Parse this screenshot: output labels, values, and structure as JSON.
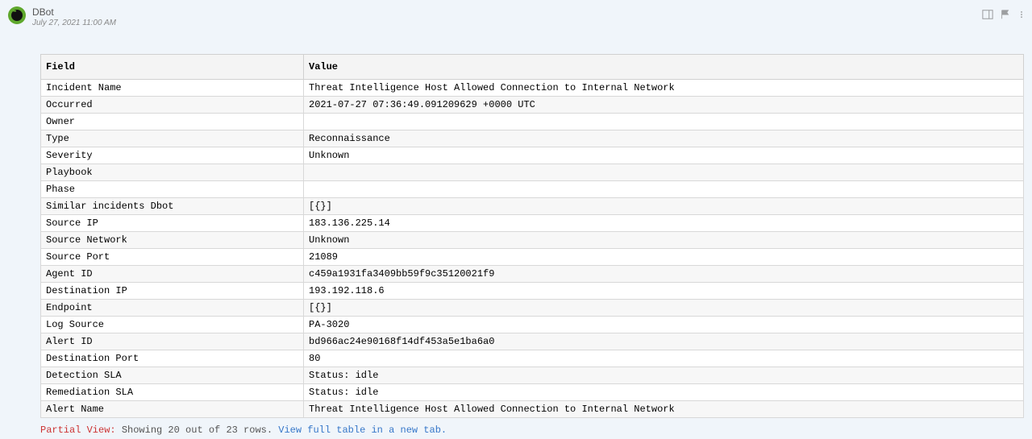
{
  "message": {
    "author": "DBot",
    "timestamp": "July 27, 2021 11:00 AM"
  },
  "table": {
    "headers": {
      "field": "Field",
      "value": "Value"
    },
    "rows": [
      {
        "field": "Incident Name",
        "value": "Threat Intelligence Host Allowed Connection to Internal Network"
      },
      {
        "field": "Occurred",
        "value": "2021-07-27 07:36:49.091209629 +0000 UTC"
      },
      {
        "field": "Owner",
        "value": ""
      },
      {
        "field": "Type",
        "value": "Reconnaissance"
      },
      {
        "field": "Severity",
        "value": "Unknown"
      },
      {
        "field": "Playbook",
        "value": ""
      },
      {
        "field": "Phase",
        "value": ""
      },
      {
        "field": "Similar incidents Dbot",
        "value": "[{}]"
      },
      {
        "field": "Source IP",
        "value": "183.136.225.14"
      },
      {
        "field": "Source Network",
        "value": "Unknown"
      },
      {
        "field": "Source Port",
        "value": "21089"
      },
      {
        "field": "Agent ID",
        "value": "c459a1931fa3409bb59f9c35120021f9"
      },
      {
        "field": "Destination IP",
        "value": "193.192.118.6"
      },
      {
        "field": "Endpoint",
        "value": "[{}]"
      },
      {
        "field": "Log Source",
        "value": "PA-3020"
      },
      {
        "field": "Alert ID",
        "value": "bd966ac24e90168f14df453a5e1ba6a0"
      },
      {
        "field": "Destination Port",
        "value": "80"
      },
      {
        "field": "Detection SLA",
        "value": "Status: idle"
      },
      {
        "field": "Remediation SLA",
        "value": "Status: idle"
      },
      {
        "field": "Alert Name",
        "value": "Threat Intelligence Host Allowed Connection to Internal Network"
      }
    ]
  },
  "footer": {
    "partial_label": "Partial View:",
    "showing_text": " Showing 20 out of 23 rows. ",
    "link_text": "View full table in a new tab.",
    "period": ""
  }
}
